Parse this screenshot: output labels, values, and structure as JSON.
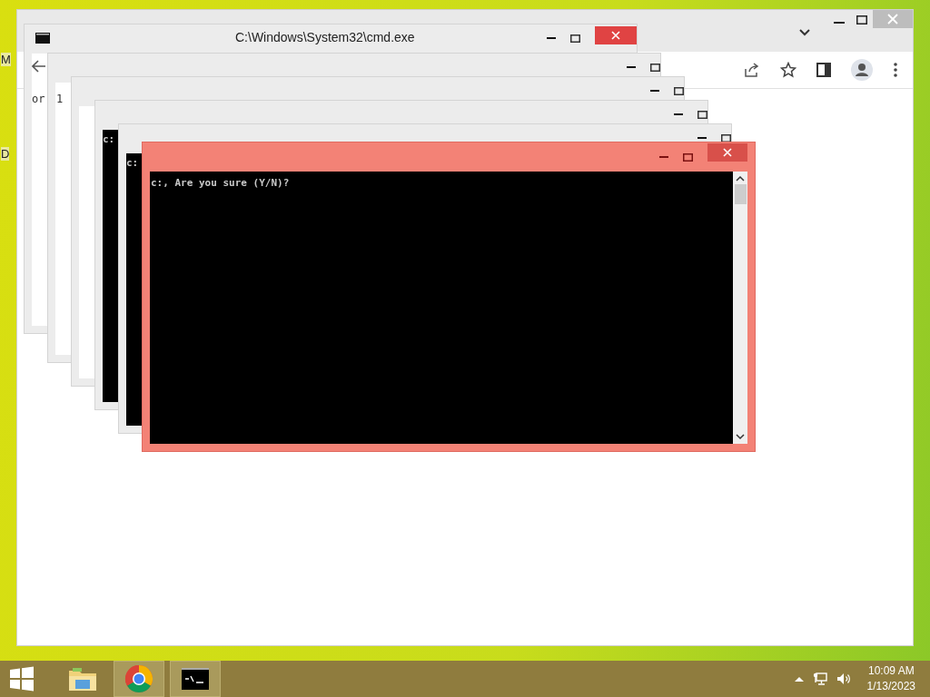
{
  "desktop": {
    "icon_labels": [
      "M",
      "D"
    ]
  },
  "browser": {
    "page_fragments": [
      "or",
      "1"
    ]
  },
  "console_stack": [
    {
      "title": "C:\\Windows\\System32\\cmd.exe",
      "dark": false
    },
    {
      "dark": false
    },
    {
      "dark": false
    },
    {
      "dark": true,
      "prompt": "c:"
    },
    {
      "dark": true,
      "prompt": "c:"
    }
  ],
  "active_console": {
    "text": "c:, Are you sure (Y/N)?"
  },
  "taskbar": {
    "items": [
      {
        "kind": "explorer",
        "running": false
      },
      {
        "kind": "chrome",
        "running": true
      },
      {
        "kind": "cmd",
        "running": true
      }
    ],
    "time": "10:09 AM",
    "date": "1/13/2023"
  }
}
